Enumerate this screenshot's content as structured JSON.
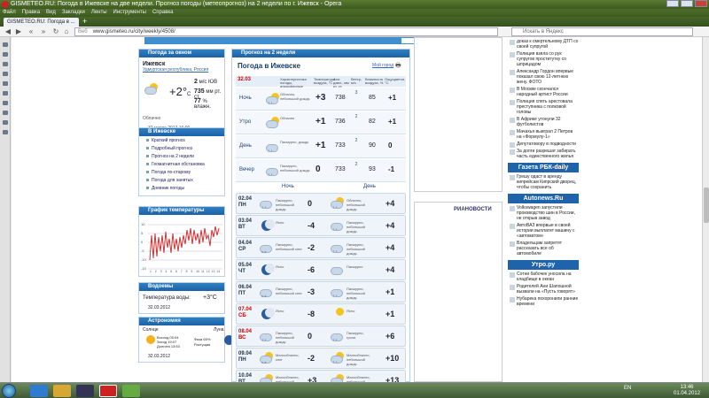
{
  "window": {
    "title": "GISMETEO.RU: Погода в Ижевске на две недели. Прогноз погоды (метеопрогноз) на 2 недели по г. Ижевск - Opera"
  },
  "menu": [
    "Файл",
    "Правка",
    "Вид",
    "Закладки",
    "Ленты",
    "Инструменты",
    "Справка"
  ],
  "tabs": [
    {
      "label": "GISMETEO.RU: Погода в ..."
    }
  ],
  "address": {
    "label": "Веб",
    "url": "www.gismeteo.ru/city/weekly/4508/"
  },
  "search": {
    "placeholder": "Искать в Яндекс"
  },
  "now": {
    "header": "Погода за окном",
    "city": "Ижевск",
    "region": "Удмуртская республика, Россия",
    "temp": "+2°",
    "temp_unit": "C",
    "wind": "2",
    "wind_unit": "м/с ЮВ",
    "pressure": "735",
    "pressure_unit": "мм рт. ст.",
    "humidity": "77",
    "humidity_unit": "% влажн.",
    "cond": "Облачно",
    "datetime": "32 марта 2012 16:00"
  },
  "city_links": {
    "header": "В Ижевске",
    "items": [
      "Краткий прогноз",
      "Подробный прогноз",
      "Прогноз на 2 недели",
      "Геомагнитная обстановка",
      "Погода по-старому",
      "Погода для занятых",
      "Дневник погоды"
    ]
  },
  "graph": {
    "header": "График температуры",
    "ylabels": [
      "10",
      "5",
      "0",
      "-5",
      "-10",
      "-15"
    ],
    "xlabels": [
      "1",
      "2",
      "3",
      "4",
      "5",
      "6",
      "7",
      "8",
      "9",
      "10",
      "11",
      "12",
      "13",
      "14"
    ]
  },
  "water": {
    "header": "Водоемы",
    "label": "Температура воды:",
    "value": "+3°C",
    "date": "32.03.2012"
  },
  "astro": {
    "header": "Астрономия",
    "sun_label": "Солнце",
    "moon_label": "Луна",
    "sun_lines": [
      "Восход 05:04",
      "Заход 19:07",
      "Долгота 13:53"
    ],
    "moon_lines": [
      "Фаза 65%",
      "Растущая"
    ],
    "date": "32.03.2012"
  },
  "forecast": {
    "header": "Прогноз на 2 недели",
    "title": "Погода в Ижевске",
    "my_label": "Мой город",
    "date": "32.03",
    "cols": [
      "Характеристика погоды, атмосферные явления",
      "Температура воздуха, °C",
      "Атм. давл., мм рт. ст.",
      "Ветер, м/с",
      "Влажность воздуха, %",
      "Ощущается, °C"
    ],
    "tod": [
      {
        "name": "Ночь",
        "desc": "Облачно, небольшой дождь",
        "temp": "+3",
        "pres": "738",
        "wind": "3",
        "hum": "85",
        "feel": "+1"
      },
      {
        "name": "Утро",
        "desc": "Облачно",
        "temp": "+1",
        "pres": "736",
        "wind": "2",
        "hum": "82",
        "feel": "+1"
      },
      {
        "name": "День",
        "desc": "Пасмурно, дождь",
        "temp": "+1",
        "pres": "733",
        "wind": "2",
        "hum": "90",
        "feel": "0"
      },
      {
        "name": "Вечер",
        "desc": "Пасмурно, небольшой дождь",
        "temp": "0",
        "pres": "733",
        "wind": "2",
        "hum": "93",
        "feel": "-1"
      }
    ],
    "night_label": "Ночь",
    "day_label": "День",
    "days": [
      {
        "d": "02.04",
        "w": "ПН",
        "nd": "Пасмурно, небольшой дождь",
        "nt": "0",
        "dd": "Облачно, небольшой дождь",
        "dt": "+4",
        "we": false
      },
      {
        "d": "03.04",
        "w": "ВТ",
        "nd": "Ясно",
        "nt": "-4",
        "dd": "Пасмурно, небольшой дождь",
        "dt": "+4",
        "we": false
      },
      {
        "d": "04.04",
        "w": "СР",
        "nd": "Пасмурно, небольшой снег",
        "nt": "-2",
        "dd": "Пасмурно, небольшой дождь",
        "dt": "+4",
        "we": false
      },
      {
        "d": "05.04",
        "w": "ЧТ",
        "nd": "Ясно",
        "nt": "-6",
        "dd": "Пасмурно",
        "dt": "+4",
        "we": false
      },
      {
        "d": "06.04",
        "w": "ПТ",
        "nd": "Пасмурно, небольшой снег",
        "nt": "-3",
        "dd": "Пасмурно, небольшой дождь",
        "dt": "+1",
        "we": false
      },
      {
        "d": "07.04",
        "w": "СБ",
        "nd": "Ясно",
        "nt": "-8",
        "dd": "Ясно",
        "dt": "+1",
        "we": true
      },
      {
        "d": "08.04",
        "w": "ВС",
        "nd": "Пасмурно, небольшой дождь",
        "nt": "0",
        "dd": "Пасмурно, гроза",
        "dt": "+6",
        "we": true
      },
      {
        "d": "09.04",
        "w": "ПН",
        "nd": "Малооблачно, снег",
        "nt": "-2",
        "dd": "Малооблачно, небольшой дождь",
        "dt": "+10",
        "we": false
      },
      {
        "d": "10.04",
        "w": "ВТ",
        "nd": "Малооблачно, небольшой дождь",
        "nt": "+3",
        "dd": "Малооблачно, небольшой дождь",
        "dt": "+13",
        "we": false
      }
    ]
  },
  "ria_label": "РИАНОВОСТИ",
  "news_top": [
    "доказ к смертельному ДТП со своей супругой",
    "Полиция взяла со рук супругов проститутку со шприцадом",
    "Александр Гордон впервые показал свою 12-летнюю жену. ФОТО",
    "В Москве скончался народный артист России",
    "Полиция спять арестовала преступника с полковой головы",
    "В Африке утонули 32 футболистов",
    "Мачахья выиграл 2 Петров на «Формулу-1»",
    "Депутатовору в подводности",
    "За долги разрешат забирать часть единственного жилья"
  ],
  "sec1": {
    "header": "Газета РБК-daily",
    "items": [
      "Грешу одаст в аренду кипрейсам Кипрский дворец, чтобы сохранить"
    ]
  },
  "sec2": {
    "header": "Autonews.Ru",
    "items": [
      "Volkswagen запустили производство шин в России, не открыв завод",
      "АвтоВАЗ впервые в своей истории выплатит машину с «автоматом»",
      "Владельцам запретят рассказать все об автомобиле"
    ]
  },
  "sec3": {
    "header": "Утро.ру",
    "items": [
      "Сотни бабочек уносила на кладбище в океан",
      "Родителей Ани Шапошной вызвали на «Пусть говорят»",
      "Нубарека похоронили ранние времени"
    ]
  },
  "taskbar": {
    "lang": "EN",
    "time": "13:46",
    "date": "01.04.2012"
  }
}
